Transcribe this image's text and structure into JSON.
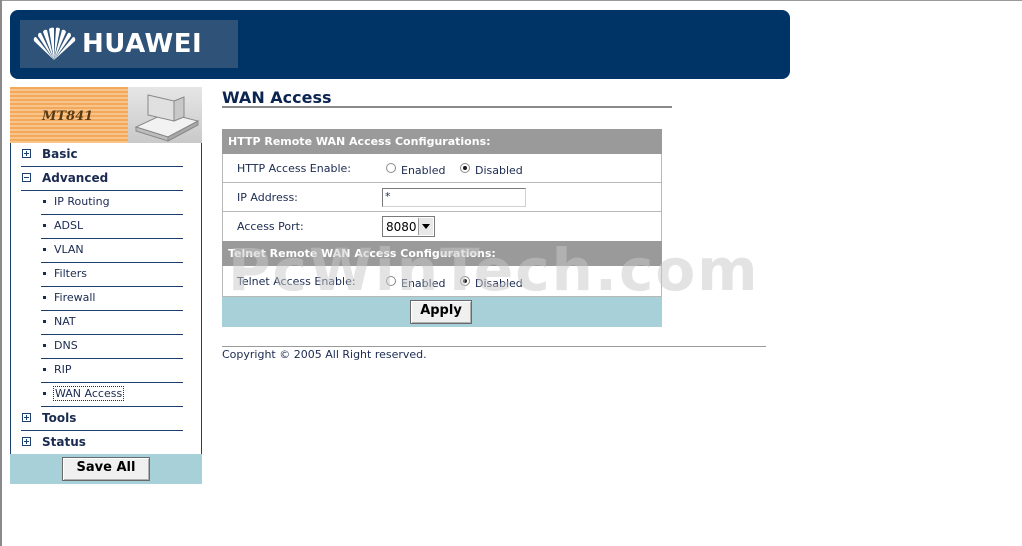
{
  "brand": {
    "logo_text": "HUAWEI",
    "logo_icon": "huawei-fan-icon"
  },
  "sidebar": {
    "model_label": "MT841",
    "menu": [
      {
        "label": "Basic",
        "expanded": false
      },
      {
        "label": "Advanced",
        "expanded": true,
        "items": [
          "IP Routing",
          "ADSL",
          "VLAN",
          "Filters",
          "Firewall",
          "NAT",
          "DNS",
          "RIP",
          "WAN Access"
        ]
      },
      {
        "label": "Tools",
        "expanded": false
      },
      {
        "label": "Status",
        "expanded": false
      }
    ],
    "active_item": "WAN Access",
    "save_all_label": "Save All"
  },
  "main": {
    "page_title": "WAN Access",
    "http_section": {
      "header": "HTTP Remote WAN Access Configurations:",
      "enable_label": "HTTP Access Enable:",
      "enabled_label": "Enabled",
      "disabled_label": "Disabled",
      "selected": "Disabled",
      "ip_label": "IP Address:",
      "ip_value": "*",
      "port_label": "Access Port:",
      "port_value": "8080"
    },
    "telnet_section": {
      "header": "Telnet Remote WAN Access Configurations:",
      "enable_label": "Telnet Access Enable:",
      "enabled_label": "Enabled",
      "disabled_label": "Disabled",
      "selected": "Disabled"
    },
    "apply_label": "Apply",
    "copyright": "Copyright © 2005 All Right reserved."
  },
  "watermark": "PcWinTech.com",
  "colors": {
    "banner": "#003366",
    "section_header": "#9a9a9a",
    "button_bar": "#a8d0d8",
    "menu_border": "#1c3f6e"
  }
}
